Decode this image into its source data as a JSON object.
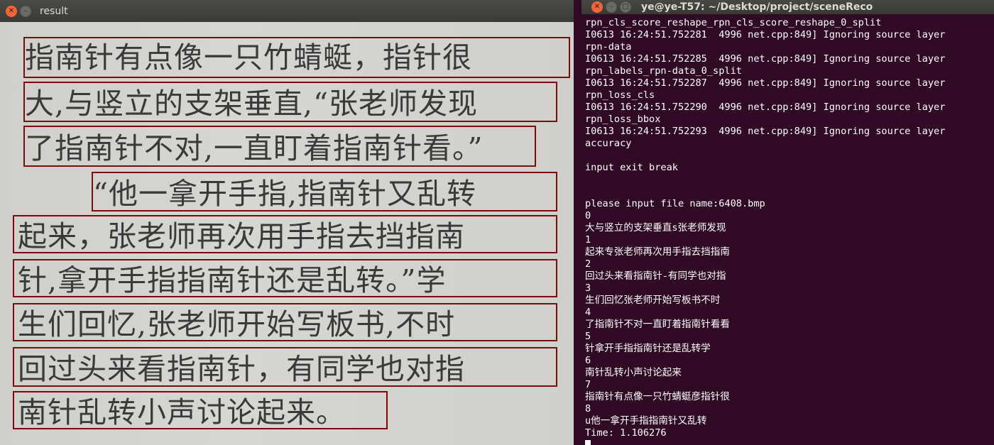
{
  "left_window": {
    "title": "result",
    "lines": [
      "指南针有点像一只竹蜻蜓，指针很",
      "大,与竖立的支架垂直,“张老师发现",
      "了指南针不对,一直盯着指南针看。”",
      "“他一拿开手指,指南针又乱转",
      "起来，张老师再次用手指去挡指南",
      "针,拿开手指指南针还是乱转。”学",
      "生们回忆,张老师开始写板书,不时",
      "回过头来看指南针，有同学也对指",
      "南针乱转小声讨论起来。"
    ]
  },
  "terminal_window": {
    "title": "ye@ye-T57: ~/Desktop/project/sceneReco",
    "lines": [
      "rpn_cls_score_reshape_rpn_cls_score_reshape_0_split",
      "I0613 16:24:51.752281  4996 net.cpp:849] Ignoring source layer",
      "rpn-data",
      "I0613 16:24:51.752285  4996 net.cpp:849] Ignoring source layer",
      "rpn_labels_rpn-data_0_split",
      "I0613 16:24:51.752287  4996 net.cpp:849] Ignoring source layer",
      "rpn_loss_cls",
      "I0613 16:24:51.752290  4996 net.cpp:849] Ignoring source layer",
      "rpn_loss_bbox",
      "I0613 16:24:51.752293  4996 net.cpp:849] Ignoring source layer",
      "accuracy",
      "",
      "input exit break",
      "",
      "",
      "please input file name:6408.bmp",
      "0",
      "大与竖立的支架垂直s张老师发现",
      "1",
      "起来专张老师再次用手指去挡指南",
      "2",
      "回过头来看指南针-有同学也对指",
      "3",
      "生们回忆张老师开始写板书不时",
      "4",
      "了指南针不对一直盯着指南针看看",
      "5",
      "针拿开手指指南针还是乱转学",
      "6",
      "南针乱转小声讨论起来",
      "7",
      "指南针有点像一只竹蜻蜓彦指针很",
      "8",
      "u他一拿开手指指南针又乱转",
      "Time: 1.106276"
    ]
  },
  "colors": {
    "box_border": "#7c0c0c",
    "terminal_bg": "#300a24",
    "close_button": "#f0663a"
  }
}
